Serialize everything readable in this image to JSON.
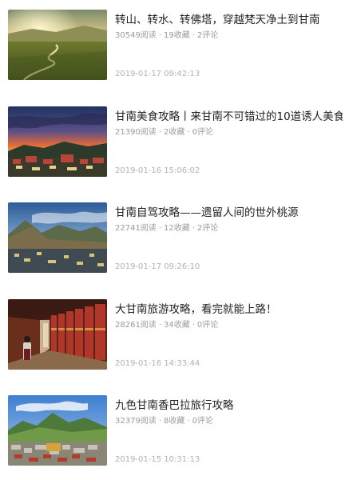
{
  "articles": [
    {
      "title": "转山、转水、转佛塔，穿越梵天净土到甘南",
      "reads": "30549阅读",
      "favorites": "19收藏",
      "comments": "2评论",
      "date": "2019-01-17 09:42:13",
      "thumb_icon": "grassland-river-sunset-photo"
    },
    {
      "title": "甘南美食攻略丨来甘南不可错过的10道诱人美食！",
      "reads": "21390阅读",
      "favorites": "2收藏",
      "comments": "0评论",
      "date": "2019-01-16 15:06:02",
      "thumb_icon": "monastery-sunset-sky-photo"
    },
    {
      "title": "甘南自驾攻略——遗留人间的世外桃源",
      "reads": "22741阅读",
      "favorites": "12收藏",
      "comments": "2评论",
      "date": "2019-01-17 09:26:10",
      "thumb_icon": "mountain-town-dusk-photo"
    },
    {
      "title": "大甘南旅游攻略，看完就能上路！",
      "reads": "28261阅读",
      "favorites": "34收藏",
      "comments": "0评论",
      "date": "2019-01-16 14:33:44",
      "thumb_icon": "prayer-wheel-corridor-photo"
    },
    {
      "title": "九色甘南香巴拉旅行攻略",
      "reads": "32379阅读",
      "favorites": "8收藏",
      "comments": "0评论",
      "date": "2019-01-15 10:31:13",
      "thumb_icon": "monastery-mountain-valley-photo"
    }
  ],
  "meta_separator": "·",
  "colors": {
    "title": "#222222",
    "meta": "#9b9b9b",
    "date": "#b3b3b3"
  }
}
